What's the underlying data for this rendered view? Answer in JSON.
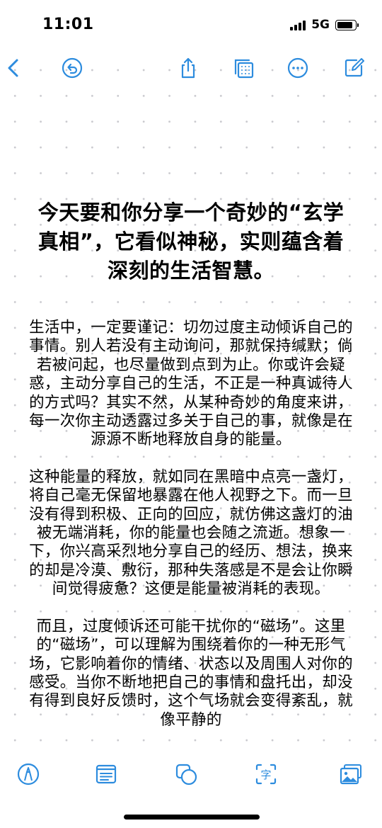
{
  "status_bar": {
    "time": "11:01",
    "network": "5G",
    "signal_bars": 4,
    "battery_level": 0.85
  },
  "toolbar": {
    "icons": [
      "chevron-left-icon",
      "undo-icon",
      "share-icon",
      "gallery-view-icon",
      "more-icon",
      "compose-icon"
    ],
    "accent_color": "#2d8cde"
  },
  "note": {
    "title": "今天要和你分享一个奇妙的“玄学真相”，它看似神秘，实则蕴含着深刻的生活智慧。",
    "paragraphs": [
      "生活中，一定要谨记：切勿过度主动倾诉自己的事情。别人若没有主动询问，那就保持缄默；倘若被问起，也尽量做到点到为止。你或许会疑惑，主动分享自己的生活，不正是一种真诚待人的方式吗？其实不然，从某种奇妙的角度来讲，每一次你主动透露过多关于自己的事，就像是在源源不断地释放自身的能量。",
      "这种能量的释放，就如同在黑暗中点亮一盏灯，将自己毫无保留地暴露在他人视野之下。而一旦没有得到积极、正向的回应，就仿佛这盏灯的油被无端消耗，你的能量也会随之流逝。想象一下，你兴高采烈地分享自己的经历、想法，换来的却是冷漠、敷衍，那种失落感是不是会让你瞬间觉得疲惫？这便是能量被消耗的表现。",
      "而且，过度倾诉还可能干扰你的“磁场”。这里的“磁场”，可以理解为围绕着你的一种无形气场，它影响着你的情绪、状态以及周围人对你的感受。当你不断地把自己的事情和盘托出，却没有得到良好反馈时，这个气场就会变得紊乱，就像平静的"
    ]
  },
  "bottom_bar": {
    "icons": [
      "markup-icon",
      "checklist-icon",
      "shapes-icon",
      "text-recognition-icon",
      "photo-icon"
    ],
    "text_recognition_glyph": "字"
  }
}
